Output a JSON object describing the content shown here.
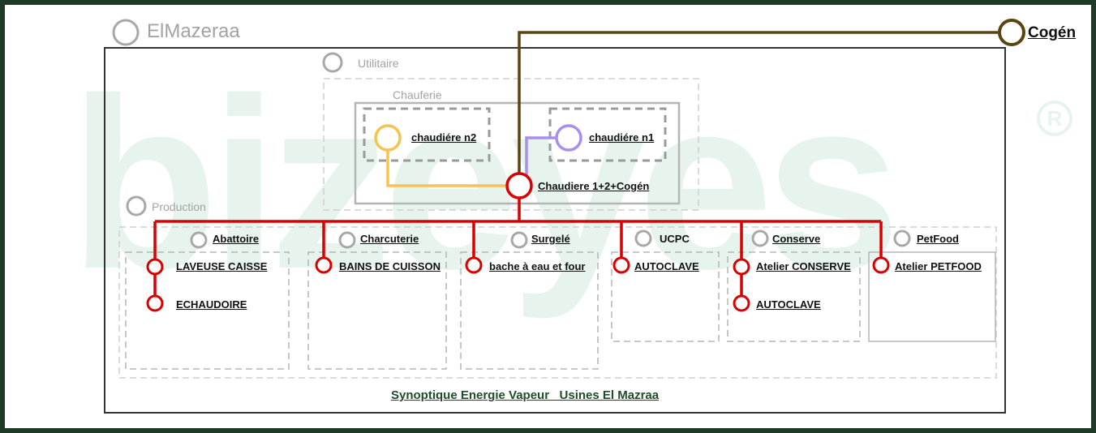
{
  "watermark": "bizeyes",
  "watermark_mark": "R",
  "site": {
    "label": "ElMazeraa"
  },
  "external": {
    "label": "Cogén"
  },
  "utilitaire": {
    "label": "Utilitaire"
  },
  "chauferie": {
    "label": "Chauferie",
    "boiler_n2": "chaudiére n2",
    "boiler_n1": "chaudiére n1",
    "hub": "Chaudiere 1+2+Cogén"
  },
  "production": {
    "label": "Production",
    "abattoire": {
      "label": "Abattoire",
      "items": [
        "LAVEUSE CAISSE",
        "ECHAUDOIRE"
      ]
    },
    "charcuterie": {
      "label": "Charcuterie",
      "items": [
        "BAINS DE CUISSON"
      ]
    },
    "surgele": {
      "label": "Surgelé",
      "items": [
        "bache à eau et four"
      ]
    },
    "ucpc": {
      "label": "UCPC",
      "items": [
        "AUTOCLAVE"
      ]
    },
    "conserve": {
      "label": "Conserve",
      "items": [
        "Atelier CONSERVE",
        "AUTOCLAVE"
      ]
    },
    "petfood": {
      "label": "PetFood",
      "items": [
        "Atelier PETFOOD"
      ]
    }
  },
  "footer": {
    "title": "Synoptique Energie Vapeur _Usines El Mazraa"
  },
  "colors": {
    "frame": "#1f3a27",
    "steam": "#d90000",
    "cogen": "#5a4510",
    "boiler_n2": "#f5c451",
    "boiler_n1": "#a98ef0",
    "grey_node": "#a8a8a8",
    "watermark": "#e7f4ee"
  }
}
